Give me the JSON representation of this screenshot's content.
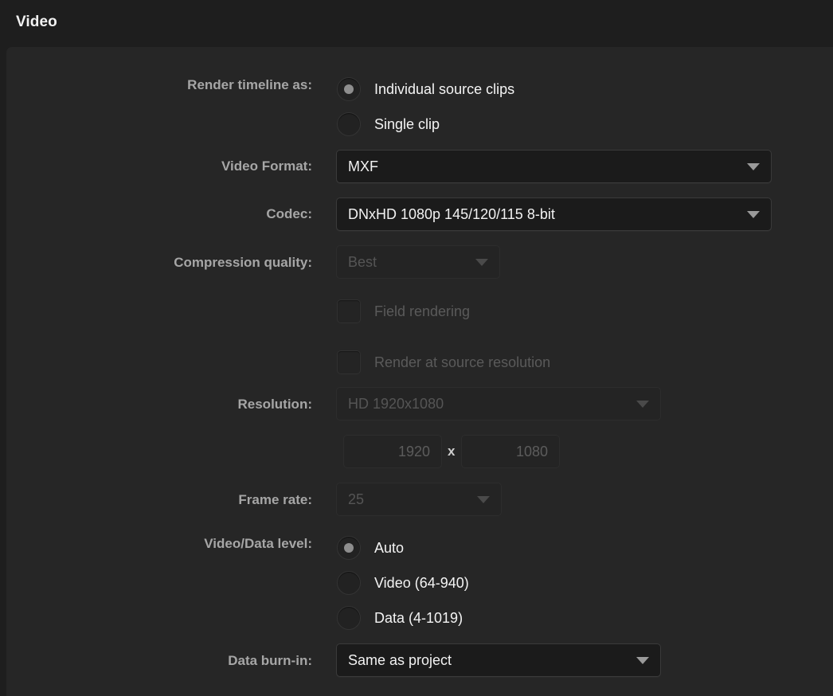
{
  "header": {
    "title": "Video"
  },
  "fields": {
    "render_timeline": {
      "label": "Render timeline as:",
      "options": [
        {
          "label": "Individual source clips",
          "selected": true
        },
        {
          "label": "Single clip",
          "selected": false
        }
      ]
    },
    "video_format": {
      "label": "Video Format:",
      "value": "MXF",
      "enabled": true
    },
    "codec": {
      "label": "Codec:",
      "value": "DNxHD 1080p 145/120/115 8-bit",
      "enabled": true
    },
    "compression_quality": {
      "label": "Compression quality:",
      "value": "Best",
      "enabled": false
    },
    "field_rendering": {
      "label": "Field rendering",
      "checked": false,
      "enabled": false
    },
    "render_at_source_resolution": {
      "label": "Render at source resolution",
      "checked": false,
      "enabled": false
    },
    "resolution": {
      "label": "Resolution:",
      "value": "HD 1920x1080",
      "enabled": false
    },
    "resolution_width": {
      "value": "1920",
      "enabled": false
    },
    "resolution_separator": "x",
    "resolution_height": {
      "value": "1080",
      "enabled": false
    },
    "frame_rate": {
      "label": "Frame rate:",
      "value": "25",
      "enabled": false
    },
    "video_data_level": {
      "label": "Video/Data level:",
      "options": [
        {
          "label": "Auto",
          "selected": true
        },
        {
          "label": "Video (64-940)",
          "selected": false
        },
        {
          "label": "Data (4-1019)",
          "selected": false
        }
      ]
    },
    "data_burn_in": {
      "label": "Data burn-in:",
      "value": "Same as project",
      "enabled": true
    }
  },
  "icons": {
    "dropdown_arrow": "chevron-down-icon"
  },
  "colors": {
    "window_bg": "#1e1e1e",
    "panel_bg": "#262626",
    "label": "#a6a6a6",
    "text": "#f2f2f2",
    "disabled_text": "#555555",
    "control_bg": "#1b1b1b",
    "disabled_control_bg": "#242424",
    "radio_dot": "#8e8e8e"
  }
}
